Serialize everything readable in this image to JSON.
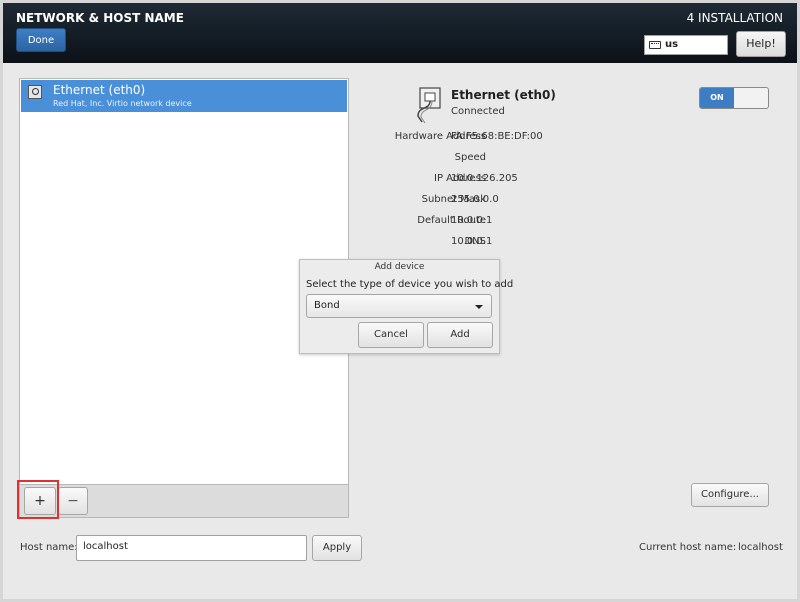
{
  "header": {
    "title": "NETWORK & HOST NAME",
    "done_label": "Done",
    "install_title": "4 INSTALLATION",
    "keyboard_layout": "us",
    "help_label": "Help!"
  },
  "device_list": {
    "items": [
      {
        "title": "Ethernet (eth0)",
        "subtitle": "Red Hat, Inc. Virtio network device",
        "selected": true
      }
    ],
    "add_label": "+",
    "remove_label": "−"
  },
  "device_detail": {
    "title": "Ethernet (eth0)",
    "status": "Connected",
    "toggle_label": "ON",
    "fields": [
      {
        "label": "Hardware Address",
        "value": "FA:F5:68:BE:DF:00"
      },
      {
        "label": "Speed",
        "value": ""
      },
      {
        "label": "IP Address",
        "value": "10.0.126.205"
      },
      {
        "label": "Subnet Mask",
        "value": "255.0.0.0"
      },
      {
        "label": "Default Route",
        "value": "10.0.0.1"
      },
      {
        "label": "DNS",
        "value": "10.0.0.1"
      }
    ],
    "configure_label": "Configure..."
  },
  "hostname": {
    "label": "Host name:",
    "value": "localhost",
    "apply_label": "Apply",
    "current_label": "Current host name:",
    "current_value": "localhost"
  },
  "dialog": {
    "title": "Add device",
    "prompt": "Select the type of device you wish to add",
    "selected_type": "Bond",
    "cancel_label": "Cancel",
    "add_label": "Add"
  },
  "colors": {
    "accent": "#3c7dc4",
    "selection": "#4a90d9",
    "highlight_box": "#e03030"
  }
}
